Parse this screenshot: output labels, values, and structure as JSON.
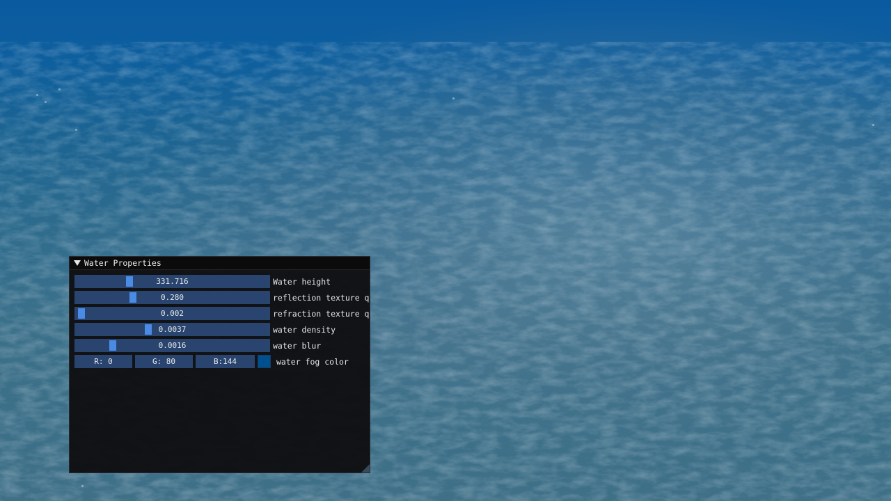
{
  "window": {
    "title": "Water Properties"
  },
  "sliders": [
    {
      "label": "Water height",
      "value": "331.716",
      "level": 0.27
    },
    {
      "label": "reflection texture quality",
      "value": "0.280",
      "level": 0.29
    },
    {
      "label": "refraction texture quality",
      "value": "0.002",
      "level": 0.01
    },
    {
      "label": "water density",
      "value": "0.0037",
      "level": 0.37
    },
    {
      "label": "water blur",
      "value": "0.0016",
      "level": 0.18
    }
  ],
  "fog_color": {
    "r_label": "R:  0",
    "g_label": "G: 80",
    "b_label": "B:144",
    "label": "water fog color",
    "swatch": "#005090"
  },
  "colors": {
    "slider_bg": "#29456f",
    "slider_grab": "#4a8be6",
    "window_bg": "#0f0f11"
  }
}
